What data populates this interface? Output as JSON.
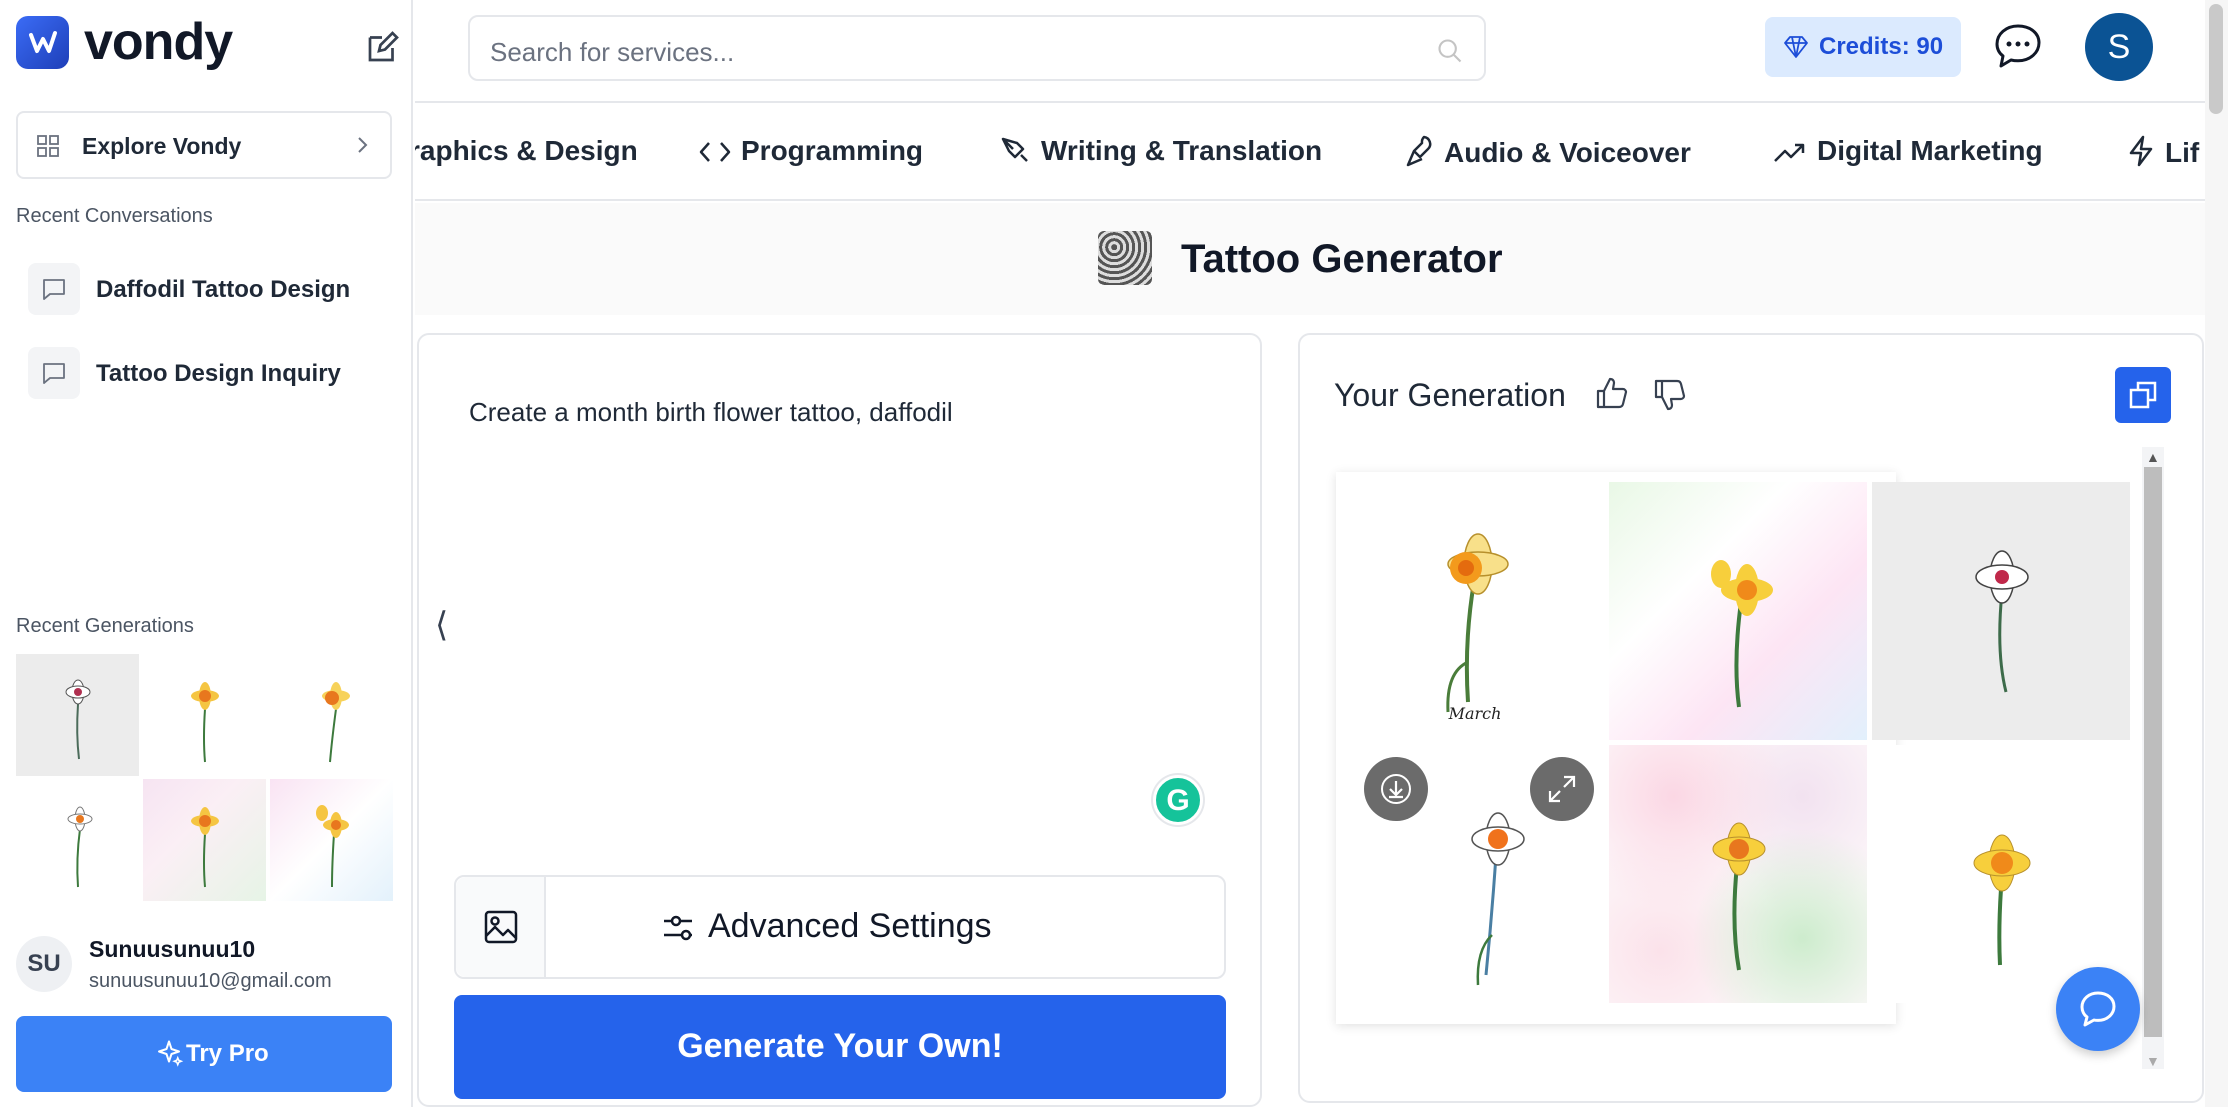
{
  "app": {
    "logo_text": "vondy"
  },
  "sidebar": {
    "explore_label": "Explore Vondy",
    "recent_conversations_title": "Recent Conversations",
    "conversations": [
      {
        "label": "Daffodil Tattoo Design"
      },
      {
        "label": "Tattoo Design Inquiry"
      }
    ],
    "recent_generations_title": "Recent Generations",
    "user": {
      "initials": "SU",
      "name": "Sunuusunuu10",
      "email": "sunuusunuu10@gmail.com"
    },
    "try_pro_label": "Try Pro"
  },
  "topbar": {
    "search_placeholder": "Search for services...",
    "credits_label": "Credits: 90",
    "avatar_initial": "S"
  },
  "categories": [
    {
      "label": "raphics & Design",
      "icon": "none"
    },
    {
      "label": "Programming",
      "icon": "code-icon"
    },
    {
      "label": "Writing & Translation",
      "icon": "pen-icon"
    },
    {
      "label": "Audio & Voiceover",
      "icon": "microphone-icon"
    },
    {
      "label": "Digital Marketing",
      "icon": "trend-icon"
    },
    {
      "label": "Lif",
      "icon": "bolt-icon"
    }
  ],
  "page": {
    "title": "Tattoo Generator"
  },
  "prompt": {
    "text": "Create a month birth flower tattoo, daffodil",
    "advanced_settings_label": "Advanced Settings",
    "generate_label": "Generate Your Own!"
  },
  "result": {
    "title": "Your Generation",
    "image_caption": "March"
  },
  "colors": {
    "brand_blue": "#2563eb",
    "credits_bg": "#dbeafe",
    "try_pro": "#3b82f6"
  }
}
